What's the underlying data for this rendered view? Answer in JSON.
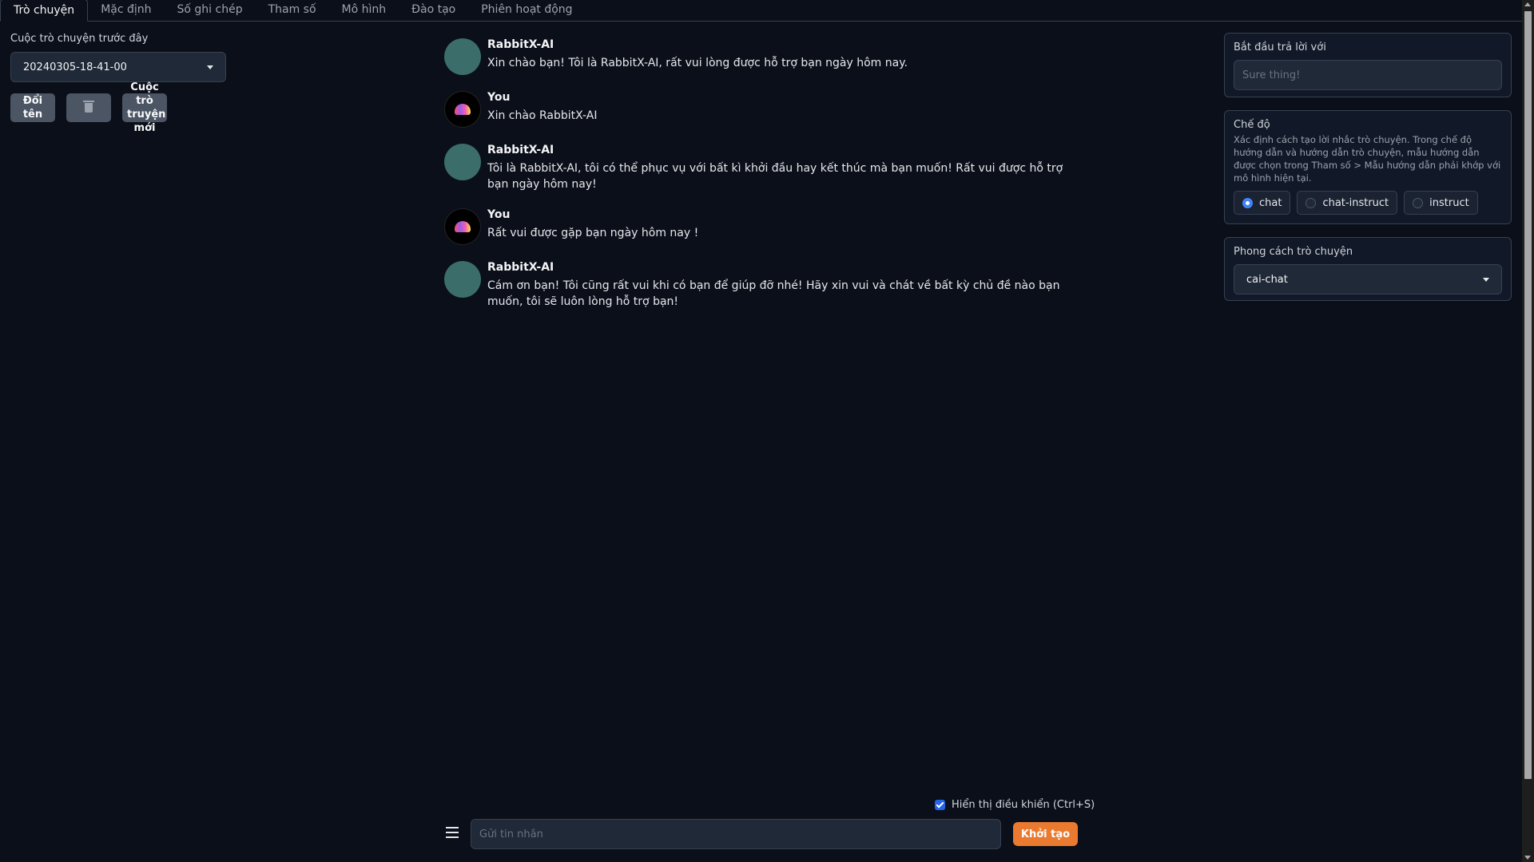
{
  "tabs": [
    {
      "label": "Trò chuyện",
      "active": true
    },
    {
      "label": "Mặc định"
    },
    {
      "label": "Số ghi chép"
    },
    {
      "label": "Tham số"
    },
    {
      "label": "Mô hình"
    },
    {
      "label": "Đào tạo"
    },
    {
      "label": "Phiên hoạt động"
    }
  ],
  "history": {
    "label": "Cuộc trò chuyện trước đây",
    "selected": "20240305-18-41-00",
    "rename_label": "Đổi tên",
    "new_label": "Cuộc trò truyện mới"
  },
  "messages": [
    {
      "role": "bot",
      "name": "RabbitX-AI",
      "text": "Xin chào bạn! Tôi là RabbitX-AI, rất vui lòng được hỗ trợ bạn ngày hôm nay."
    },
    {
      "role": "user",
      "name": "You",
      "text": "Xin chào RabbitX-AI"
    },
    {
      "role": "bot",
      "name": "RabbitX-AI",
      "text": "Tôi là RabbitX-AI, tôi có thể phục vụ với bất kì khởi đầu hay kết thúc mà bạn muốn! Rất vui được hỗ trợ bạn ngày hôm nay!"
    },
    {
      "role": "user",
      "name": "You",
      "text": "Rất vui được gặp bạn ngày hôm nay !"
    },
    {
      "role": "bot",
      "name": "RabbitX-AI",
      "text": "Cám ơn bạn! Tôi cũng rất vui khi có bạn để giúp đỡ nhé! Hãy xin vui và chát về bất kỳ chủ đề nào bạn muốn, tôi sẽ luôn lòng hỗ trợ bạn!"
    }
  ],
  "input": {
    "show_controls_label": "Hiển thị điều khiển (Ctrl+S)",
    "placeholder": "Gửi tin nhắn",
    "generate_label": "Khởi tạo"
  },
  "right": {
    "start_reply": {
      "title": "Bắt đầu trả lời với",
      "placeholder": "Sure thing!"
    },
    "mode": {
      "title": "Chế độ",
      "description": "Xác định cách tạo lời nhắc trò chuyện. Trong chế độ hướng dẫn và hướng dẫn trò chuyện, mẫu hướng dẫn được chọn trong Tham số > Mẫu hướng dẫn phải khớp với mô hình hiện tại.",
      "options": [
        "chat",
        "chat-instruct",
        "instruct"
      ],
      "selected": "chat"
    },
    "chat_style": {
      "title": "Phong cách trò chuyện",
      "selected": "cai-chat"
    }
  },
  "colors": {
    "accent": "#ea7a2f",
    "bot_avatar": "#3b6d6a",
    "radio_on": "#3b82f6"
  }
}
